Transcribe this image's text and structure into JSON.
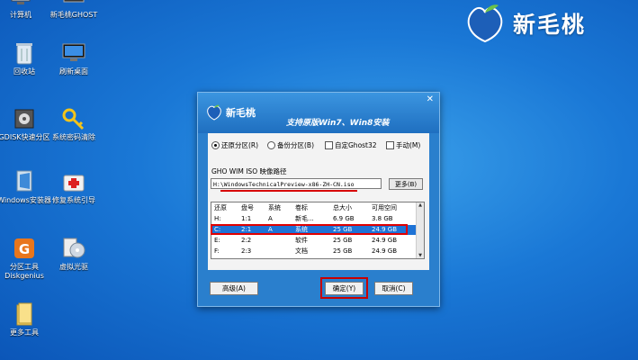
{
  "desktop": {
    "icons": [
      {
        "label": "计算机",
        "icon": "computer-icon"
      },
      {
        "label": "新毛桃GHOST",
        "icon": "ghost-icon"
      },
      {
        "label": "回收站",
        "icon": "recycle-bin-icon"
      },
      {
        "label": "刷新桌面",
        "icon": "monitor-refresh-icon"
      },
      {
        "label": "GDISK快速分区",
        "icon": "disk-partition-icon"
      },
      {
        "label": "系统密码清除",
        "icon": "key-icon"
      },
      {
        "label": "Windows安装器",
        "icon": "windows-installer-icon"
      },
      {
        "label": "修复系统引导",
        "icon": "first-aid-icon"
      },
      {
        "label": "分区工具Diskgenius",
        "icon": "diskgenius-icon"
      },
      {
        "label": "虚拟光驱",
        "icon": "virtual-drive-icon"
      },
      {
        "label": "更多工具",
        "icon": "folder-icon"
      }
    ]
  },
  "brand": {
    "name": "新毛桃",
    "accent": "#1a78d6"
  },
  "dialog": {
    "logo_text": "新毛桃",
    "slogan": "支持原版Win7、Win8安装",
    "close_glyph": "✕",
    "options": {
      "restore": "还原分区(R)",
      "backup": "备份分区(B)",
      "custom_ghost": "自定Ghost32",
      "manual": "手动(M)"
    },
    "selected_option": "restore",
    "path_label": "GHO WIM ISO 映像路径",
    "path_value": "H:\\WindowsTechnicalPreview-x86-ZH-CN.iso",
    "more_button": "更多(B)",
    "table": {
      "columns": [
        "还原",
        "盘号",
        "系统",
        "卷标",
        "总大小",
        "可用空间"
      ],
      "rows": [
        [
          "H:",
          "1:1",
          "A",
          "新毛...",
          "6.9 GB",
          "3.8 GB"
        ],
        [
          "C:",
          "2:1",
          "A",
          "系统",
          "25 GB",
          "24.9 GB"
        ],
        [
          "E:",
          "2:2",
          "",
          "软件",
          "25 GB",
          "24.9 GB"
        ],
        [
          "F:",
          "2:3",
          "",
          "文档",
          "25 GB",
          "24.9 GB"
        ]
      ],
      "selected_row": 1
    },
    "advanced_button": "高级(A)",
    "ok_button": "确定(Y)",
    "cancel_button": "取消(C)",
    "highlight_color": "#e00000"
  }
}
